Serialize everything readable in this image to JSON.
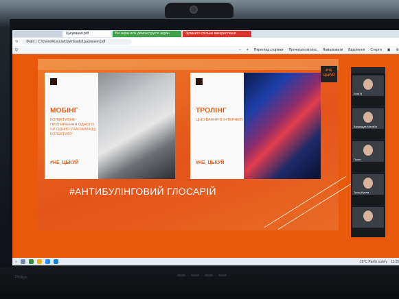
{
  "browser": {
    "tabs": [
      {
        "label": ""
      },
      {
        "label": "Цькування.pdf"
      },
      {
        "label": "Ви зараз всіх демонструєте екран"
      },
      {
        "label": "Зупинити спільне використання"
      }
    ],
    "url": "Файл | C:/Users/Ruvuua/Downloads/Цькування.pdf",
    "zoom_label": "Q"
  },
  "pdf_toolbar": {
    "page_view": "Перегляд сторінки",
    "read_aloud": "Прочитати вголос",
    "draw": "Намалювати",
    "highlight": "Виділення",
    "erase": "Стерти"
  },
  "slide": {
    "brand_logo": "#НЕ\nЦЬКУЙ",
    "cards": [
      {
        "title": "МОБІНГ",
        "description": "КОЛЕКТИВНЕ ПРИГНІЧЕННЯ ОДНОГО ЧИ ОДНІЄЇ УЧАСНИКА(Ц) КОЛЕКТИВУ",
        "tag": "#НЕ_ЦЬКУЙ"
      },
      {
        "title": "ТРОЛІНГ",
        "description": "ЦЬКУВАННЯ В ІНТЕРНЕТІ",
        "tag": "#НЕ_ЦЬКУЙ"
      }
    ],
    "title": "#АНТИБУЛІНГОВИЙ ГЛОСАРІЙ"
  },
  "participants": [
    {
      "name": "Ілля Н"
    },
    {
      "name": "Кукурудза Михайл"
    },
    {
      "name": "Полін"
    },
    {
      "name": "Трищ Кукам"
    },
    {
      "name": ""
    }
  ],
  "taskbar": {
    "search": "",
    "weather": "19°С Partly sunny",
    "time": "11:35"
  },
  "bezel": {
    "brand": "Philips"
  },
  "colors": {
    "slide_orange": "#e8590c",
    "card_accent": "#e0621e"
  }
}
